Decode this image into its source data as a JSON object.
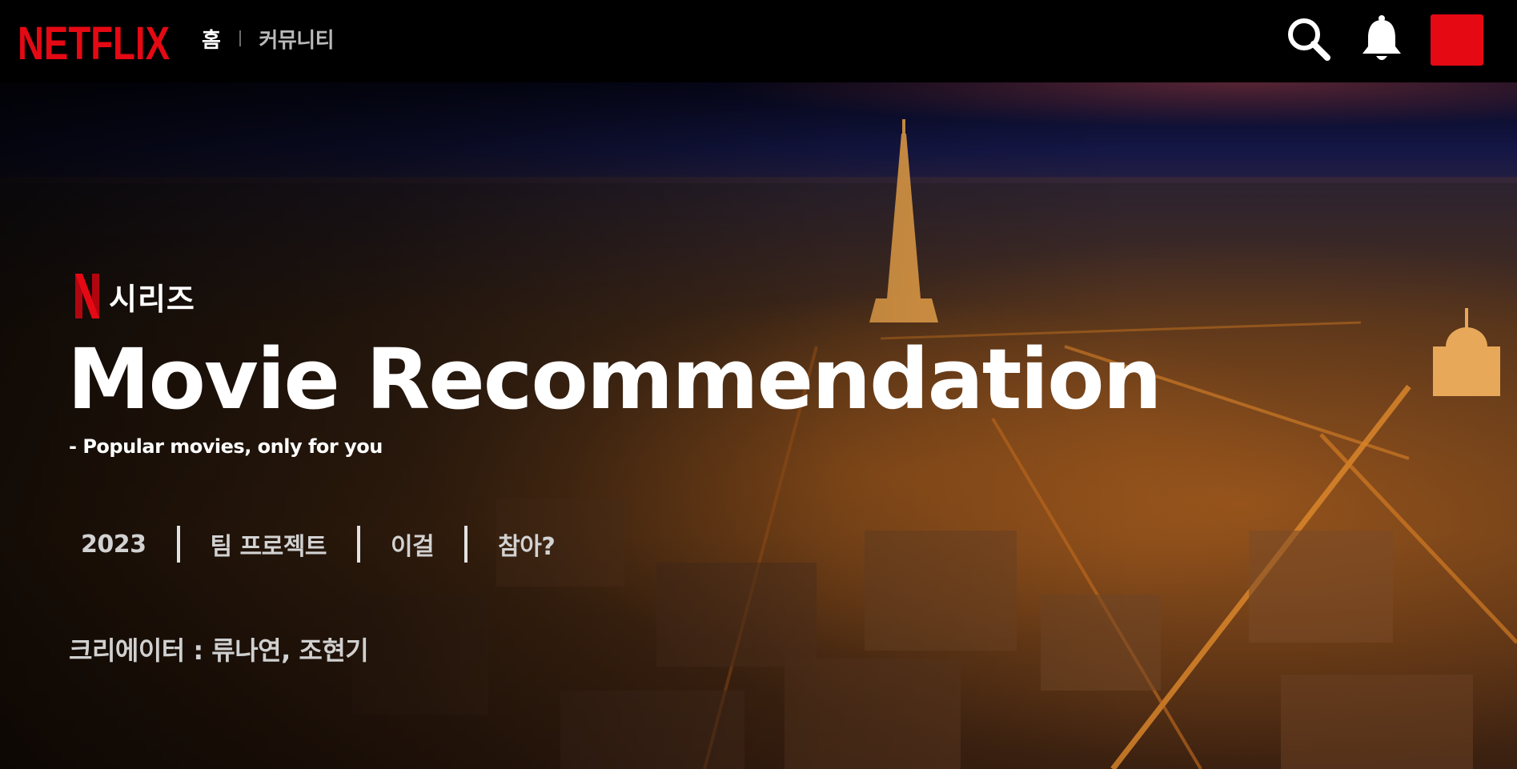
{
  "header": {
    "logo_text": "NETFLIX",
    "nav": [
      {
        "label": "홈",
        "active": true
      },
      {
        "label": "커뮤니티",
        "active": false
      }
    ],
    "icons": [
      "search-icon",
      "bell-icon",
      "profile-avatar"
    ]
  },
  "hero": {
    "badge": "시리즈",
    "title": "Movie Recommendation",
    "subtitle": "- Popular movies, only for you",
    "meta": [
      "2023",
      "팀 프로젝트",
      "이걸",
      "참아?"
    ],
    "creator": "크리에이터 : 류나연, 조현기"
  },
  "colors": {
    "brand_red": "#e50914",
    "nav_bg": "#000000",
    "dim_text": "#b9b9b9"
  }
}
